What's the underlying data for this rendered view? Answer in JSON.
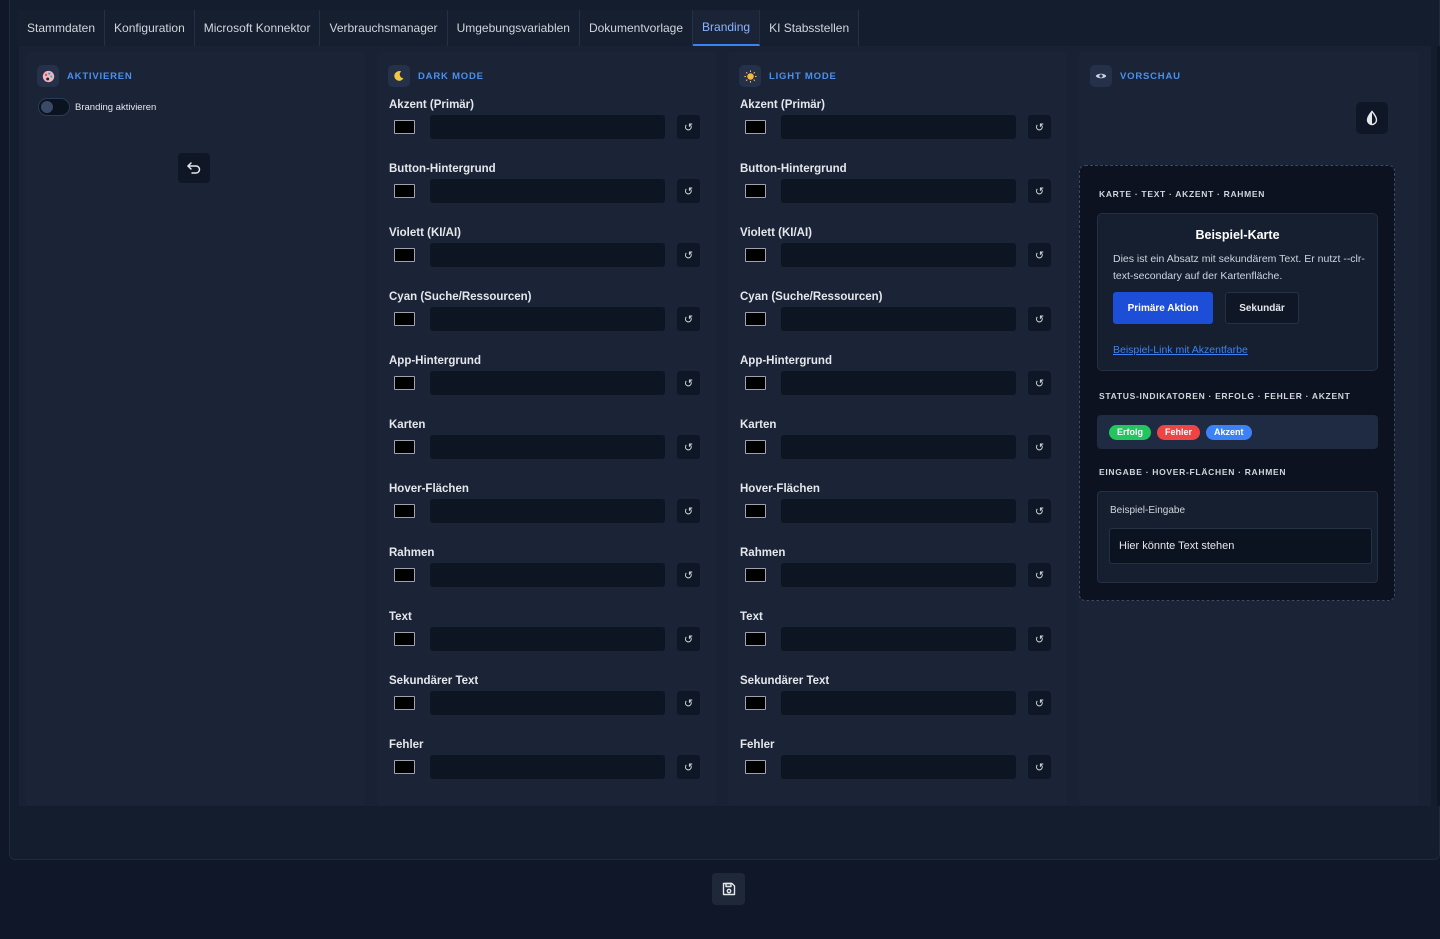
{
  "tabs": [
    {
      "label": "Stammdaten"
    },
    {
      "label": "Konfiguration"
    },
    {
      "label": "Microsoft Konnektor"
    },
    {
      "label": "Verbrauchsmanager"
    },
    {
      "label": "Umgebungsvariablen"
    },
    {
      "label": "Dokumentvorlage"
    },
    {
      "label": "Branding"
    },
    {
      "label": "KI Stabsstellen"
    }
  ],
  "active_tab": "Branding",
  "activate": {
    "title": "AKTIVIEREN",
    "toggle_label": "Branding aktivieren",
    "toggle_on": false
  },
  "dark_mode": {
    "title": "DARK MODE",
    "rows": [
      {
        "label": "Akzent (Primär)",
        "value": ""
      },
      {
        "label": "Button-Hintergrund",
        "value": ""
      },
      {
        "label": "Violett (KI/AI)",
        "value": ""
      },
      {
        "label": "Cyan (Suche/Ressourcen)",
        "value": ""
      },
      {
        "label": "App-Hintergrund",
        "value": ""
      },
      {
        "label": "Karten",
        "value": ""
      },
      {
        "label": "Hover-Flächen",
        "value": ""
      },
      {
        "label": "Rahmen",
        "value": ""
      },
      {
        "label": "Text",
        "value": ""
      },
      {
        "label": "Sekundärer Text",
        "value": ""
      },
      {
        "label": "Fehler",
        "value": ""
      }
    ]
  },
  "light_mode": {
    "title": "LIGHT MODE",
    "rows": [
      {
        "label": "Akzent (Primär)",
        "value": ""
      },
      {
        "label": "Button-Hintergrund",
        "value": ""
      },
      {
        "label": "Violett (KI/AI)",
        "value": ""
      },
      {
        "label": "Cyan (Suche/Ressourcen)",
        "value": ""
      },
      {
        "label": "App-Hintergrund",
        "value": ""
      },
      {
        "label": "Karten",
        "value": ""
      },
      {
        "label": "Hover-Flächen",
        "value": ""
      },
      {
        "label": "Rahmen",
        "value": ""
      },
      {
        "label": "Text",
        "value": ""
      },
      {
        "label": "Sekundärer Text",
        "value": ""
      },
      {
        "label": "Fehler",
        "value": ""
      }
    ]
  },
  "reset_glyph": "↺",
  "preview": {
    "title": "VORSCHAU",
    "card_section_title": "KARTE · TEXT · AKZENT · RAHMEN",
    "card_title": "Beispiel-Karte",
    "card_text": "Dies ist ein Absatz mit sekundärem Text. Er nutzt --clr-text-secondary auf der Kartenfläche.",
    "primary_button": "Primäre Aktion",
    "secondary_button": "Sekundär",
    "link_text": "Beispiel-Link mit Akzentfarbe",
    "status_section_title": "STATUS-INDIKATOREN · ERFOLG · FEHLER · AKZENT",
    "badges": [
      {
        "label": "Erfolg",
        "color": "#22c55e"
      },
      {
        "label": "Fehler",
        "color": "#ef4444"
      },
      {
        "label": "Akzent",
        "color": "#3b82f6"
      }
    ],
    "input_section_title": "EINGABE · HOVER-FLÄCHEN · RAHMEN",
    "input_label": "Beispiel-Eingabe",
    "input_value": "Hier könnte Text stehen"
  },
  "icons": {
    "activate": "palette-icon",
    "dark_mode": "moon-icon",
    "light_mode": "sun-icon",
    "preview": "eye-icon",
    "contrast": "contrast-icon",
    "undo": "undo-icon",
    "save": "save-icon"
  },
  "colors": {
    "accent": "#3b82f6",
    "primary_button": "#1d4ed8",
    "success": "#22c55e",
    "error": "#ef4444"
  }
}
